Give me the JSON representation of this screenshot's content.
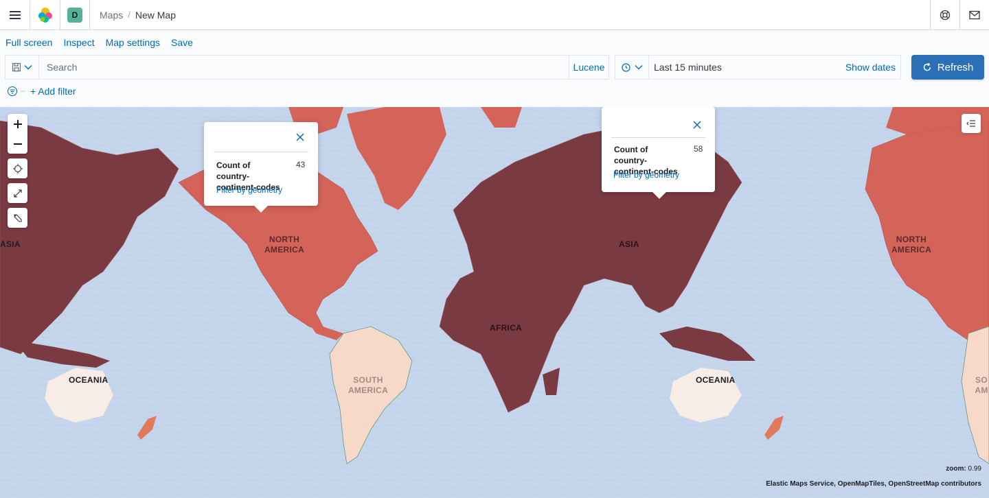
{
  "header": {
    "space_initial": "D",
    "breadcrumbs": [
      "Maps",
      "New Map"
    ],
    "crumb_sep": "/"
  },
  "top_menu": [
    "Full screen",
    "Inspect",
    "Map settings",
    "Save"
  ],
  "query": {
    "placeholder": "Search",
    "language": "Lucene"
  },
  "date_picker": {
    "range": "Last 15 minutes",
    "show_dates": "Show dates"
  },
  "refresh_label": "Refresh",
  "add_filter": "+ Add filter",
  "popups": [
    {
      "label": "Count of country-continent-codes",
      "value": "43",
      "action": "Filter by geometry"
    },
    {
      "label": "Count of country-continent-codes",
      "value": "58",
      "action": "Filter by geometry"
    }
  ],
  "continent_labels": {
    "asia_left": "ASIA",
    "north_america": "NORTH AMERICA",
    "asia": "ASIA",
    "africa": "AFRICA",
    "oceania_left": "OCEANIA",
    "south_america": "SOUTH AMERICA",
    "oceania_right": "OCEANIA",
    "north_america_right": "NORTH AMERICA",
    "south_america_right": "SO AM"
  },
  "zoom": {
    "label": "zoom:",
    "value": "0.99"
  },
  "attribution": "Elastic Maps Service, OpenMapTiles, OpenStreetMap contributors",
  "colors": {
    "water": "#c5d5ec",
    "dark_fill": "#7a3a42",
    "mid_fill": "#d4635a",
    "light_fill": "#f6d9c8",
    "pale_fill": "#f7ece6",
    "link": "#006bb4",
    "primary": "#2b70b7"
  },
  "icons": {
    "menu": "hamburger-icon",
    "logo": "elastic-logo",
    "help": "help-icon",
    "news": "mail-icon"
  }
}
